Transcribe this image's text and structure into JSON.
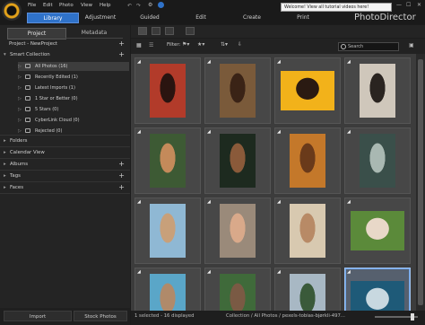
{
  "app": {
    "brand": "PhotoDirector",
    "tooltip": "Welcome! View all tutorial videos here!"
  },
  "menu": [
    "File",
    "Edit",
    "Photo",
    "View",
    "Help"
  ],
  "nav_tabs": [
    "Library",
    "Adjustment",
    "Guided",
    "Edit",
    "Create",
    "Print"
  ],
  "sidebar": {
    "tabs": [
      "Project",
      "Metadata"
    ],
    "project_label": "Project - NewProject",
    "smart_collection": "Smart Collection",
    "tree": [
      "All Photos (16)",
      "Recently Edited (1)",
      "Latest Imports (1)",
      "1 Star or Better (0)",
      "5 Stars (0)",
      "CyberLink Cloud (0)",
      "Rejected (0)"
    ],
    "sections": [
      "Folders",
      "Calendar View",
      "Albums",
      "Tags",
      "Faces"
    ],
    "buttons": [
      "Import",
      "Stock Photos"
    ]
  },
  "filter": {
    "label": "Filter:"
  },
  "search": {
    "placeholder": "Search"
  },
  "status": {
    "left": "1 selected - 16 displayed",
    "path": "Collection / All Photos / pexels-tobias-bjørkli-497..."
  },
  "photos": [
    {
      "name": "photo-1",
      "bg": "#b23b2a",
      "fg": "#2a1410",
      "orient": "portrait"
    },
    {
      "name": "photo-2",
      "bg": "#7a5a3a",
      "fg": "#3a2316",
      "orient": "portrait"
    },
    {
      "name": "photo-3",
      "bg": "#f2b21a",
      "fg": "#2a1a12",
      "orient": "landscape"
    },
    {
      "name": "photo-4",
      "bg": "#cfc7bb",
      "fg": "#2a2420",
      "orient": "portrait"
    },
    {
      "name": "photo-5",
      "bg": "#3d5a34",
      "fg": "#c48a5a",
      "orient": "portrait"
    },
    {
      "name": "photo-6",
      "bg": "#1d2a1f",
      "fg": "#8a5a3a",
      "orient": "portrait"
    },
    {
      "name": "photo-7",
      "bg": "#c4782a",
      "fg": "#6a3a1a",
      "orient": "portrait"
    },
    {
      "name": "photo-8",
      "bg": "#3a4f4a",
      "fg": "#a9b8b2",
      "orient": "portrait"
    },
    {
      "name": "photo-9",
      "bg": "#8fb8d4",
      "fg": "#c8a07a",
      "orient": "portrait"
    },
    {
      "name": "photo-10",
      "bg": "#9a8a7a",
      "fg": "#d9a98a",
      "orient": "portrait"
    },
    {
      "name": "photo-11",
      "bg": "#d8c9b0",
      "fg": "#b88a66",
      "orient": "portrait"
    },
    {
      "name": "photo-12",
      "bg": "#5b8a3a",
      "fg": "#e8d8c8",
      "orient": "landscape"
    },
    {
      "name": "photo-13",
      "bg": "#5aa6c8",
      "fg": "#b08a6a",
      "orient": "portrait"
    },
    {
      "name": "photo-14",
      "bg": "#3f6a3a",
      "fg": "#7a5a44",
      "orient": "portrait"
    },
    {
      "name": "photo-15",
      "bg": "#a8b8c4",
      "fg": "#3a5a3a",
      "orient": "portrait"
    },
    {
      "name": "photo-16",
      "bg": "#1e5a78",
      "fg": "#c8d8e0",
      "orient": "landscape"
    }
  ],
  "colors": {
    "accent": "#2f72c9",
    "selection": "#9fc3f0"
  }
}
